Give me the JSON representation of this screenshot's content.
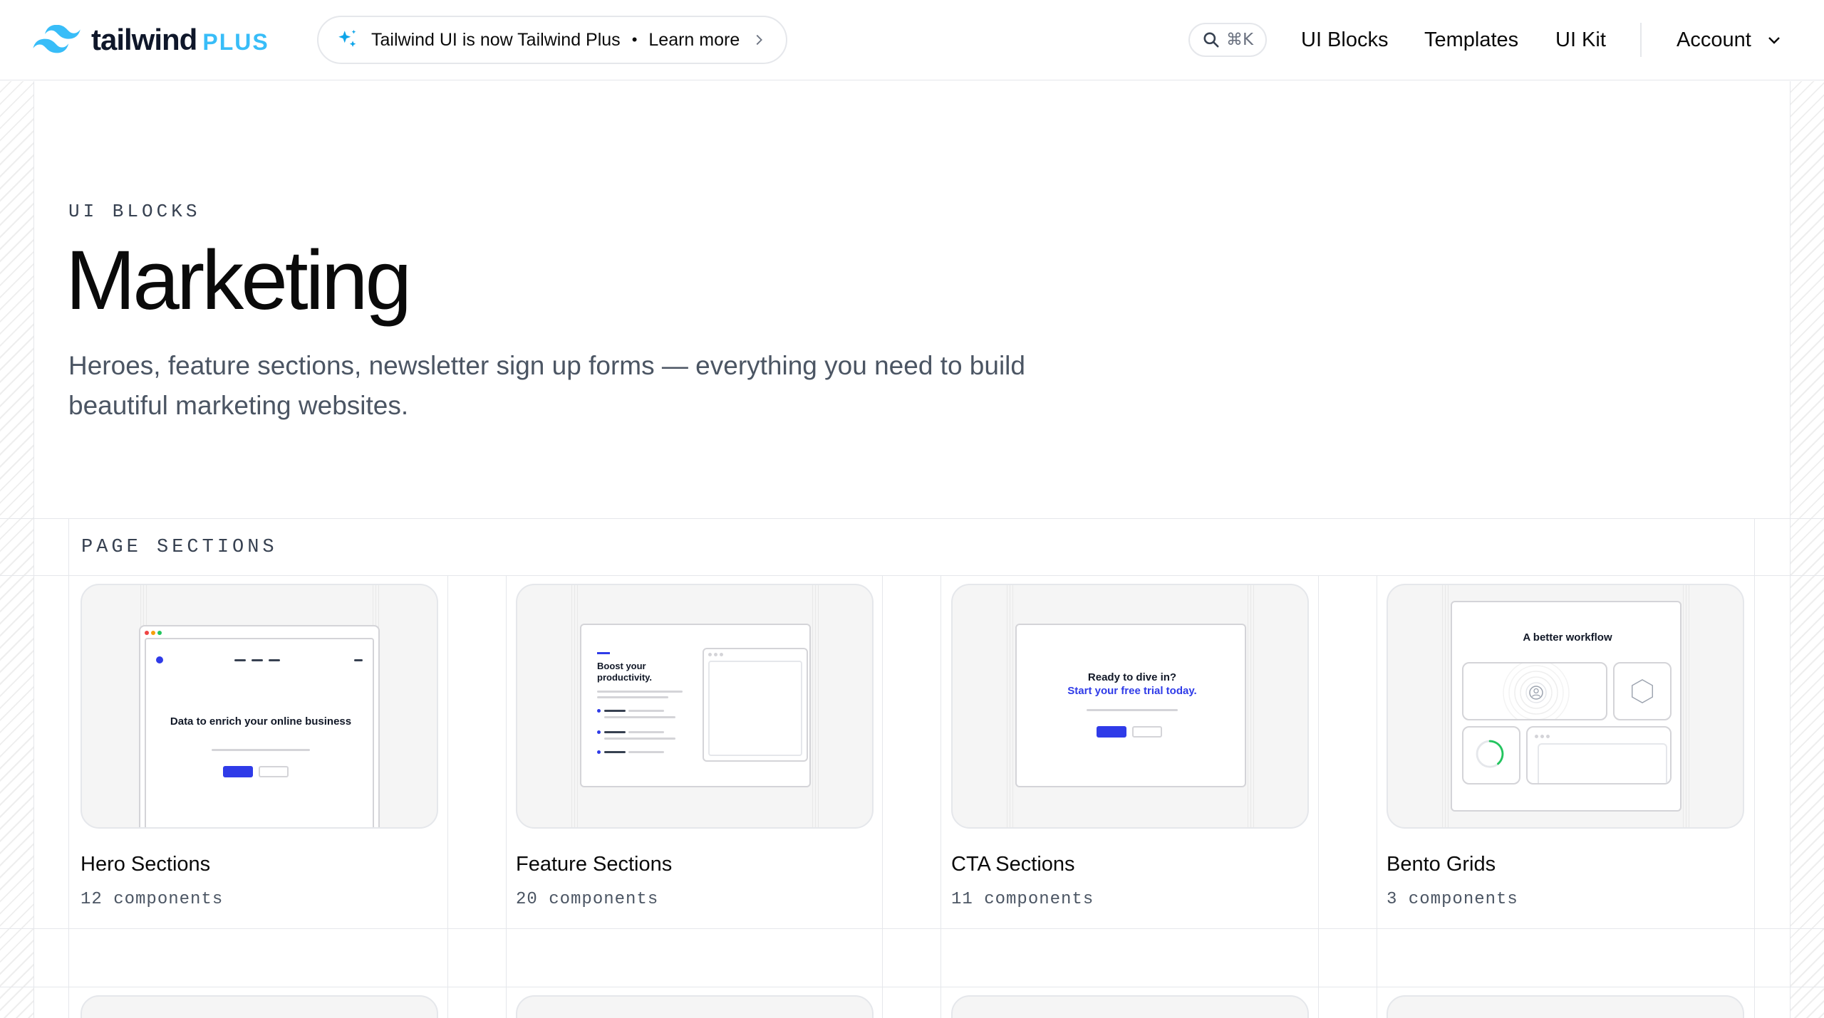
{
  "header": {
    "logo_word": "tailwind",
    "logo_plus": "PLUS",
    "announcement_text": "Tailwind UI is now Tailwind Plus",
    "announcement_separator": "•",
    "announcement_link": "Learn more",
    "search_shortcut": "⌘K",
    "nav": {
      "ui_blocks": "UI Blocks",
      "templates": "Templates",
      "ui_kit": "UI Kit",
      "account": "Account"
    }
  },
  "hero": {
    "eyebrow": "UI BLOCKS",
    "title": "Marketing",
    "description": "Heroes, feature sections, newsletter sign up forms — everything you need to build beautiful marketing websites."
  },
  "section": {
    "label": "PAGE SECTIONS",
    "cards": [
      {
        "name": "Hero Sections",
        "count": "12 components",
        "thumb_heading": "Data to enrich your online business"
      },
      {
        "name": "Feature Sections",
        "count": "20 components",
        "thumb_heading": "Boost your productivity."
      },
      {
        "name": "CTA Sections",
        "count": "11 components",
        "thumb_heading": "Ready to dive in?",
        "thumb_subheading": "Start your free trial today."
      },
      {
        "name": "Bento Grids",
        "count": "3 components",
        "thumb_heading": "A better workflow"
      }
    ]
  },
  "colors": {
    "brand_blue": "#38bdf8",
    "button_blue": "#2f3be8",
    "text_primary": "#0a0a0a",
    "text_secondary": "#4b5563",
    "border": "#e5e7eb"
  }
}
